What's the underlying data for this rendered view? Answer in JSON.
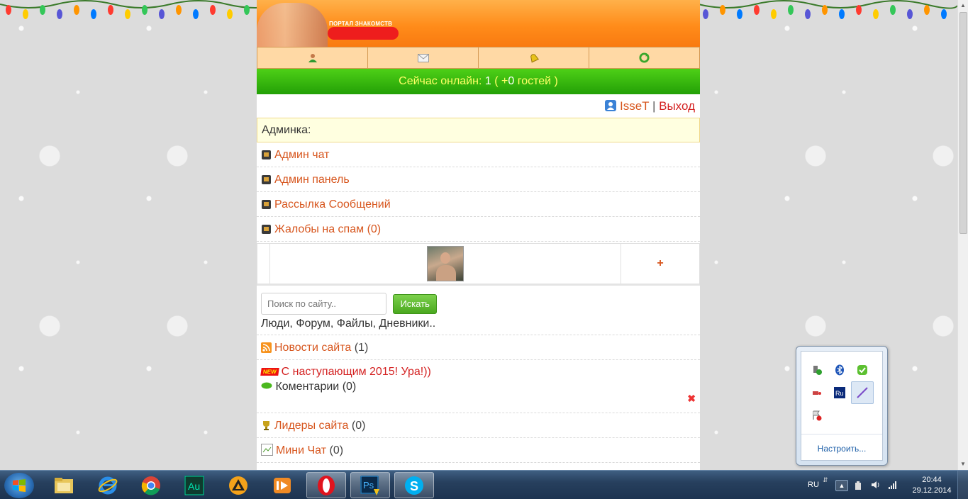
{
  "header": {
    "logo_tagline": "ПОРТАЛ ЗНАКОМСТВ"
  },
  "online": {
    "prefix": "Сейчас онлайн:",
    "count": "1",
    "guests_open": "( +",
    "guests": "0",
    "guests_close": "гостей )"
  },
  "user": {
    "name": "IsseT",
    "separator": "|",
    "logout": "Выход"
  },
  "admin": {
    "title": "Админка:",
    "items": [
      {
        "label": "Админ чат",
        "count": ""
      },
      {
        "label": "Админ панель",
        "count": ""
      },
      {
        "label": "Рассылка Сообщений",
        "count": ""
      },
      {
        "label": "Жалобы на спам",
        "count": "(0)"
      }
    ]
  },
  "photos": {
    "add_label": "+"
  },
  "search": {
    "placeholder": "Поиск по сайту..",
    "button": "Искать",
    "hint": "Люди, Форум, Файлы, Дневники.."
  },
  "news": {
    "label": "Новости сайта",
    "count": "(1)",
    "badge": "NEW",
    "headline": "С наступающим 2015! Ура!))",
    "comments_label": "Коментарии",
    "comments_count": "(0)",
    "delete_glyph": "✖"
  },
  "leaders": {
    "label": "Лидеры сайта",
    "count": "(0)"
  },
  "mini_chat": {
    "label": "Мини Чат",
    "count": "(0)"
  },
  "tray_popup": {
    "customize": "Настроить..."
  },
  "taskbar": {
    "language": "RU",
    "time": "20:44",
    "date": "29.12.2014",
    "apps": [
      "Au",
      "Ps"
    ]
  },
  "colors": {
    "link": "#d7561e",
    "logout": "#d42222",
    "online_bar": "#23a006",
    "online_text": "#ffff66",
    "header": "#ff8c1a"
  }
}
